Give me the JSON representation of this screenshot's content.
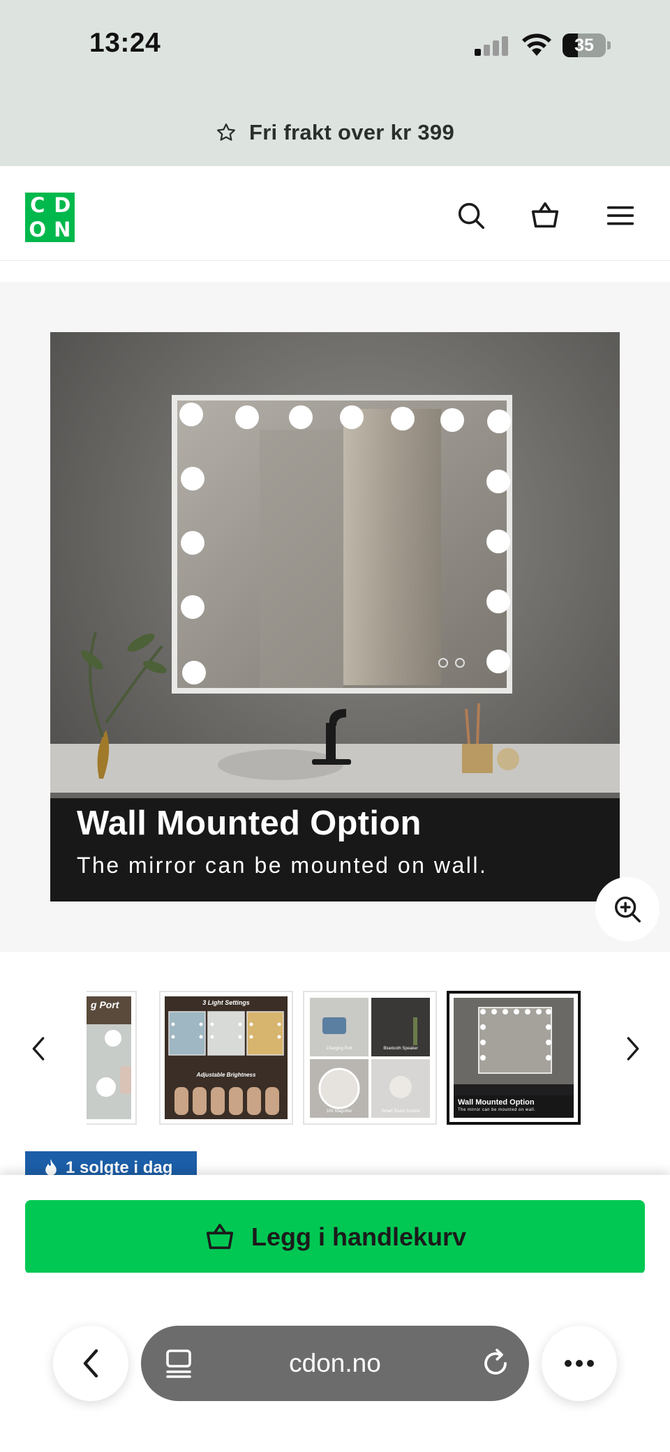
{
  "status_bar": {
    "time": "13:24",
    "battery_level": "35",
    "battery_fraction": 0.35,
    "icons": [
      "cellular-signal-icon",
      "wifi-icon",
      "battery-icon"
    ]
  },
  "promo": {
    "text": "Fri frakt over kr 399",
    "icon": "star-icon"
  },
  "header": {
    "logo_letters": [
      "C",
      "D",
      "O",
      "N"
    ],
    "brand_color": "#00b84c",
    "icons": [
      "search-icon",
      "basket-icon",
      "menu-icon"
    ]
  },
  "gallery": {
    "hero_caption_title": "Wall Mounted Option",
    "hero_caption_subtitle": "The mirror can be mounted on wall.",
    "zoom_icon": "zoom-in-icon",
    "thumbnails": [
      {
        "title": "g Port",
        "subtitle": "",
        "captions": []
      },
      {
        "title": "3 Light Settings",
        "subtitle": "Adjustable Brightness",
        "captions": []
      },
      {
        "title": "",
        "subtitle": "",
        "captions": [
          "Charging Port",
          "Bluetooth Speaker",
          "10X Magnifier",
          "Smart Touch Control"
        ]
      },
      {
        "title": "Wall Mounted Option",
        "subtitle": "The mirror can be mounted on wall.",
        "captions": []
      }
    ],
    "active_thumbnail_index": 3,
    "prev_icon": "chevron-left-icon",
    "next_icon": "chevron-right-icon"
  },
  "badge": {
    "text": "1 solgte i dag",
    "icon": "flame-icon",
    "color": "#1c5ea8"
  },
  "cart": {
    "label": "Legg i handlekurv",
    "icon": "basket-icon",
    "color": "#00c853"
  },
  "browser": {
    "url": "cdon.no",
    "icons": [
      "back-icon",
      "tabs-icon",
      "reload-icon",
      "more-icon"
    ]
  }
}
